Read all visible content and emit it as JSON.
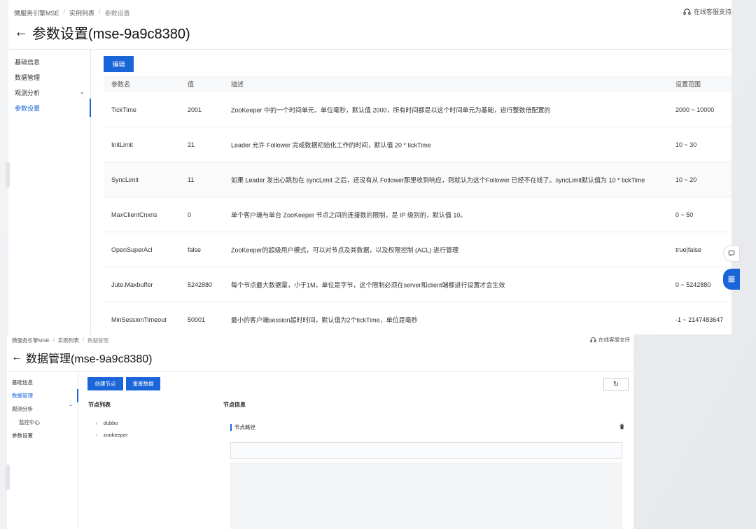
{
  "top": {
    "breadcrumb": [
      "微服务引擎MSE",
      "实例列表",
      "参数设置"
    ],
    "support_text": "在线客服支持",
    "back_arrow": "←",
    "title": "参数设置(mse-9a9c8380)",
    "sidebar": {
      "items": [
        "基础信息",
        "数据管理",
        "观测分析",
        "参数设置"
      ],
      "active_index": 3,
      "expand_chevron": "⌄"
    },
    "edit_button": "编辑",
    "table": {
      "headers": [
        "参数名",
        "值",
        "描述",
        "设置范围"
      ],
      "rows": [
        {
          "name": "TickTime",
          "value": "2001",
          "desc": "ZooKeeper 中的一个时间单元，单位毫秒，默认值 2000，所有时间都是以这个时间单元为基础，进行整数倍配置的",
          "range": "2000 ~ 10000"
        },
        {
          "name": "InitLimit",
          "value": "21",
          "desc": "Leader 允许 Follower 完成数据初始化工作的时间，默认值 20 * tickTime",
          "range": "10 ~ 30"
        },
        {
          "name": "SyncLimit",
          "value": "11",
          "desc": "如果 Leader 发出心跳包在 syncLimit 之后，还没有从 Follower那里收到响应，则就认为这个Follower 已经不在线了。syncLimit默认值为 10 * tickTime",
          "range": "10 ~ 20"
        },
        {
          "name": "MaxClientCnxns",
          "value": "0",
          "desc": "单个客户端与单台 ZooKeeper 节点之间的连接数的限制，是 IP 级别的，默认值 10。",
          "range": "0 ~ 50"
        },
        {
          "name": "OpenSuperAcl",
          "value": "false",
          "desc": "ZooKeeper的超级用户模式，可以对节点及其数据，以及权限控制 (ACL) 进行管理",
          "range": "true|false"
        },
        {
          "name": "Jute.Maxbuffer",
          "value": "5242880",
          "desc": "每个节点最大数据量，小于1M，单位是字节，这个限制必须在server和client端都进行设置才会生效",
          "range": "0 ~ 5242880"
        },
        {
          "name": "MinSessionTimeout",
          "value": "50001",
          "desc": "最小的客户端session超时时间，默认值为2个tickTime，单位是毫秒",
          "range": "-1 ~ 2147483647"
        }
      ]
    }
  },
  "bottom": {
    "breadcrumb": [
      "微服务引擎MSE",
      "实例列表",
      "数据管理"
    ],
    "support_text": "在线客服支持",
    "back_arrow": "←",
    "title": "数据管理(mse-9a9c8380)",
    "sidebar": {
      "items": [
        "基础信息",
        "数据管理",
        "观测分析",
        "监控中心",
        "参数设置"
      ],
      "active_index": 1,
      "collapse_chevron": "⌃"
    },
    "buttons": {
      "create_node": "创建节点",
      "reset_data": "重置数据"
    },
    "refresh_icon": "↻",
    "node_list_title": "节点列表",
    "node_info_title": "节点信息",
    "tree": [
      {
        "label": "dubbo",
        "toggle": "›"
      },
      {
        "label": "zookeeper",
        "toggle": "›"
      }
    ],
    "node_path_label": "节点路径",
    "trash_icon": "🗑"
  },
  "colors": {
    "accent": "#1a66d8",
    "border": "#e4e4e4",
    "header_bg": "#f7f8fa"
  }
}
